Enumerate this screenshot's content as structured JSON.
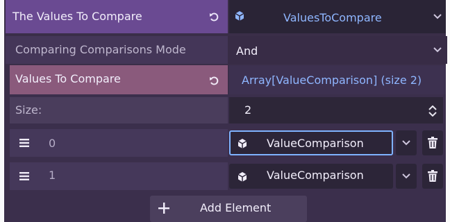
{
  "title_row": {
    "label": "The Values To Compare",
    "value": "ValuesToCompare"
  },
  "mode_row": {
    "label": "Comparing Comparisons Mode",
    "value": "And"
  },
  "values_row": {
    "label": "Values To Compare",
    "value": "Array[ValueComparison] (size 2)"
  },
  "size_row": {
    "label": "Size:",
    "value": "2"
  },
  "elements": [
    {
      "index": "0",
      "value": "ValueComparison"
    },
    {
      "index": "1",
      "value": "ValueComparison"
    }
  ],
  "add_button": {
    "label": "Add Element"
  },
  "colors": {
    "accent_purple": "#6a4a92",
    "array_row": "#8a5a7c",
    "link_blue": "#8fb6ff",
    "focus_border": "#7fb3ff"
  }
}
